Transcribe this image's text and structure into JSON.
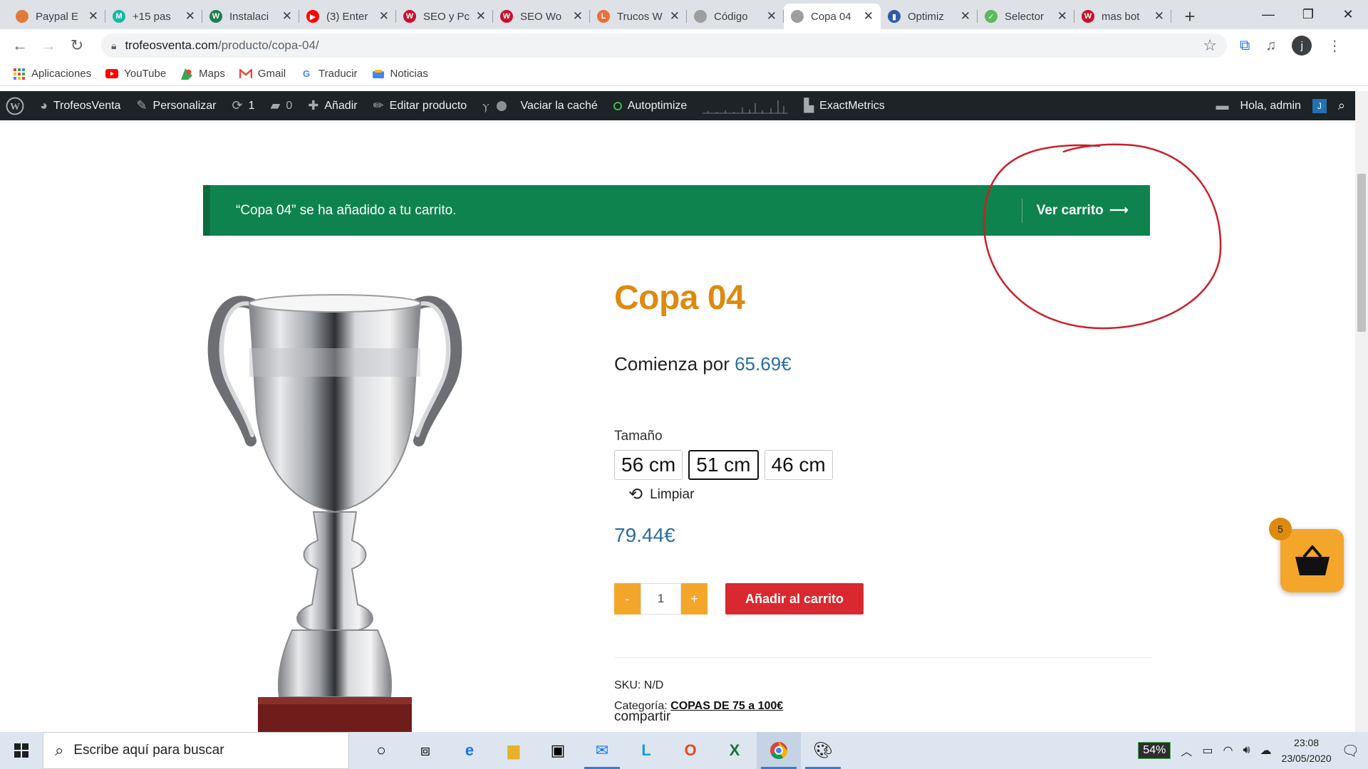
{
  "browser": {
    "tabs": [
      {
        "title": "Paypal E",
        "icon_color": "#e07b39",
        "icon_text": ""
      },
      {
        "title": "+15 pas",
        "icon_color": "#17b7a6",
        "icon_text": "M"
      },
      {
        "title": "Instalaci",
        "icon_color": "#1e7f4f",
        "icon_text": "W"
      },
      {
        "title": "(3) Enter",
        "icon_color": "#ff0000",
        "icon_text": "▶"
      },
      {
        "title": "SEO y Pc",
        "icon_color": "#c8102e",
        "icon_text": "W"
      },
      {
        "title": "SEO Wo",
        "icon_color": "#c8102e",
        "icon_text": "W"
      },
      {
        "title": "Trucos W",
        "icon_color": "#e86f3a",
        "icon_text": "L"
      },
      {
        "title": "Código",
        "icon_color": "#9e9e9e",
        "icon_text": ""
      },
      {
        "title": "Copa 04",
        "icon_color": "#9e9e9e",
        "icon_text": ""
      },
      {
        "title": "Optimiz",
        "icon_color": "#2f5aa8",
        "icon_text": "▮"
      },
      {
        "title": "Selector",
        "icon_color": "#5cb85c",
        "icon_text": "✓"
      },
      {
        "title": "mas bot",
        "icon_color": "#c8102e",
        "icon_text": "W"
      }
    ],
    "active_tab_index": 8,
    "url_domain": "trofeosventa.com",
    "url_path": "/producto/copa-04/",
    "profile_initial": "j"
  },
  "bookmarks": [
    {
      "label": "Aplicaciones",
      "icon": "apps-grid-icon"
    },
    {
      "label": "YouTube",
      "icon": "youtube-icon"
    },
    {
      "label": "Maps",
      "icon": "maps-icon"
    },
    {
      "label": "Gmail",
      "icon": "gmail-icon"
    },
    {
      "label": "Traducir",
      "icon": "translate-icon"
    },
    {
      "label": "Noticias",
      "icon": "news-icon"
    }
  ],
  "adminbar": {
    "site_name": "TrofeosVenta",
    "customize": "Personalizar",
    "updates_count": "1",
    "comments_count": "0",
    "add_new": "Añadir",
    "edit_product": "Editar producto",
    "clear_cache": "Vaciar la caché",
    "autoptimize": "Autoptimize",
    "exactmetrics": "ExactMetrics",
    "greeting": "Hola, admin",
    "avatar_letter": "J"
  },
  "notice": {
    "message": "“Copa 04” se ha añadido a tu carrito.",
    "view_cart": "Ver carrito"
  },
  "product": {
    "title": "Copa 04",
    "from_label": "Comienza por",
    "from_price": "65.69€",
    "variation_label": "Tamaño",
    "sizes": [
      "56 cm",
      "51 cm",
      "46 cm"
    ],
    "selected_size_index": 1,
    "clear_label": "Limpiar",
    "price": "79.44€",
    "qty_minus": "-",
    "quantity": "1",
    "qty_plus": "+",
    "add_to_cart": "Añadir al carrito",
    "sku_label": "SKU:",
    "sku_value": "N/D",
    "category_label": "Categoría:",
    "category_value": "COPAS DE 75 a 100€",
    "share_label": "compartir"
  },
  "floating_cart": {
    "count": "5"
  },
  "taskbar": {
    "search_placeholder": "Escribe aquí para buscar",
    "battery": "54%",
    "time": "23:08",
    "date": "23/05/2020"
  },
  "colors": {
    "notice_green": "#0f834d",
    "title_orange": "#dd8a10",
    "price_blue": "#2a6ea0",
    "add_cart_red": "#d9282f",
    "annotation_red": "#c8202a"
  }
}
